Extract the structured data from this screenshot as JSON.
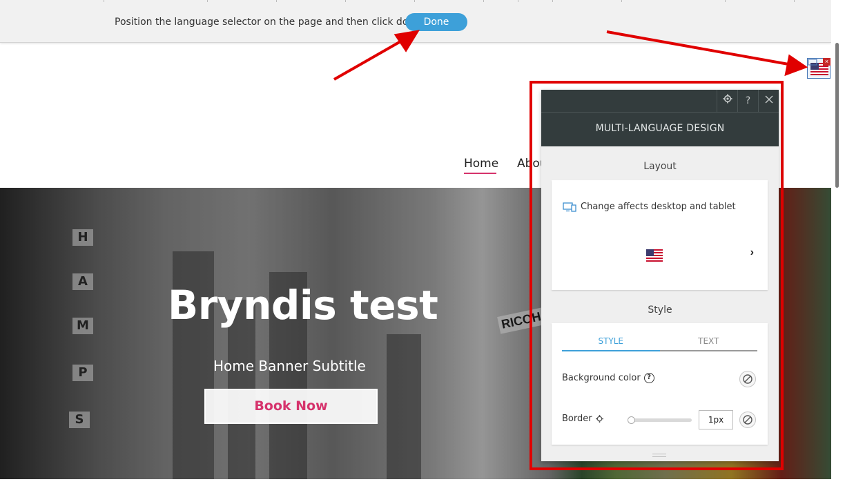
{
  "topbar": {
    "instruction": "Position the language selector on the page and then click done.",
    "done_label": "Done",
    "accent_color": "#3da0d9"
  },
  "site": {
    "nav": {
      "home": "Home",
      "about": "Abou"
    },
    "hero": {
      "title": "Bryndis test",
      "subtitle": "Home Banner Subtitle",
      "cta": "Book Now",
      "bg_signs": [
        "H",
        "A",
        "M",
        "P",
        "S",
        "RICOH"
      ]
    }
  },
  "panel": {
    "title": "MULTI-LANGUAGE DESIGN",
    "header_icons": [
      "gear-icon",
      "help-icon",
      "close-icon"
    ],
    "help_glyph": "?",
    "layout": {
      "label": "Layout",
      "affects_text": "Change affects desktop and tablet",
      "selected_flag": "us-flag-icon"
    },
    "style": {
      "label": "Style",
      "tabs": [
        "STYLE",
        "TEXT"
      ],
      "active_tab": "STYLE",
      "background_color_label": "Background color",
      "border_label": "Border",
      "border_value": "1px",
      "border_slider_fraction": 0
    }
  },
  "colors": {
    "highlight_red": "#e00000",
    "panel_header": "#333c3d",
    "brand_pink": "#d6336c"
  }
}
